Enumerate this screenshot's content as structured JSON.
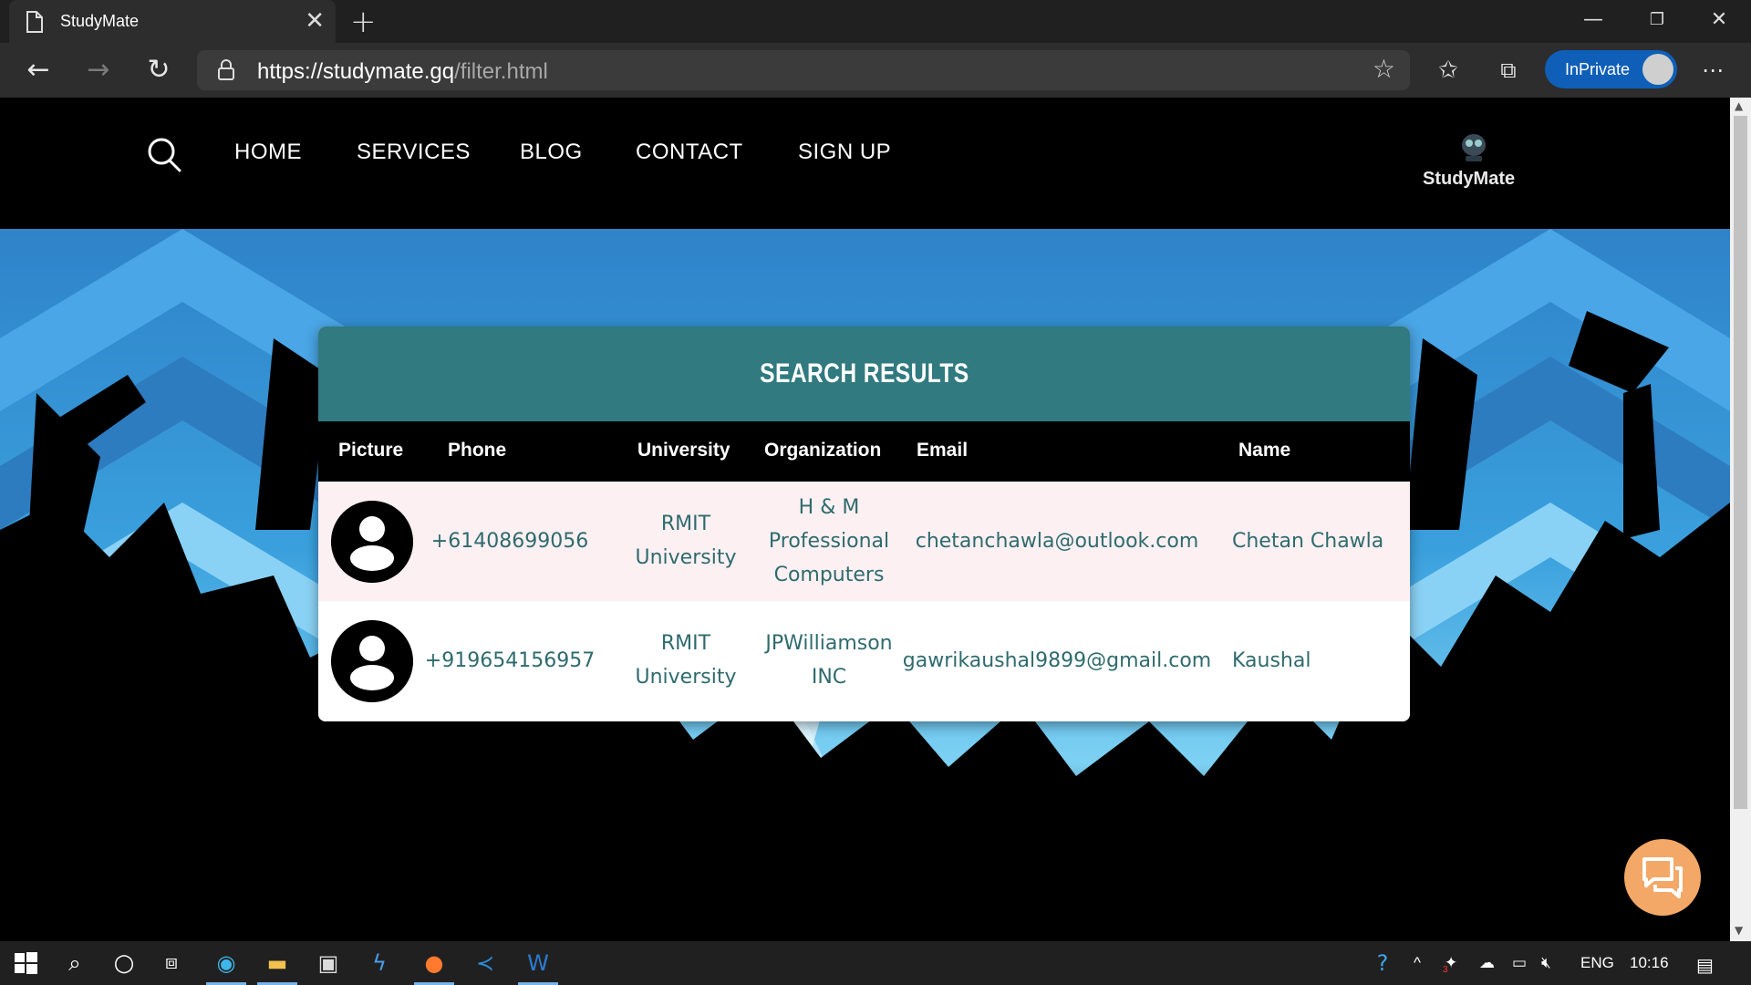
{
  "browser": {
    "tab_title": "StudyMate",
    "url_host": "https://studymate.gq",
    "url_path": "/filter.html",
    "inprivate_label": "InPrivate",
    "icons": [
      "back-icon",
      "forward-icon",
      "refresh-icon",
      "lock-icon",
      "add-favorite-icon",
      "favorites-icon",
      "collections-icon",
      "more-icon"
    ]
  },
  "nav": {
    "items": [
      "HOME",
      "SERVICES",
      "BLOG",
      "CONTACT",
      "SIGN UP"
    ],
    "logo_text": "StudyMate"
  },
  "results": {
    "title": "SEARCH RESULTS",
    "columns": [
      "Picture",
      "Phone",
      "University",
      "Organization",
      "Email",
      "Name"
    ],
    "rows": [
      {
        "phone": "+61408699056",
        "university": [
          "RMIT",
          "University"
        ],
        "organization": [
          "H & M",
          "Professional",
          "Computers"
        ],
        "email": "chetanchawla@outlook.com",
        "name": "Chetan Chawla"
      },
      {
        "phone": "+919654156957",
        "university": [
          "RMIT",
          "University"
        ],
        "organization": [
          "JPWilliamson",
          "INC"
        ],
        "email": "gawrikaushal9899@gmail.com",
        "name": "Kaushal"
      }
    ]
  },
  "taskbar": {
    "language": "ENG",
    "time": "10:16",
    "badge": "3"
  },
  "colors": {
    "header_teal": "#307a80",
    "text_teal": "#2f6b6e",
    "row_alt": "#fdf0f2",
    "chat_button": "#f3a867",
    "inprivate": "#0f5fb8"
  }
}
